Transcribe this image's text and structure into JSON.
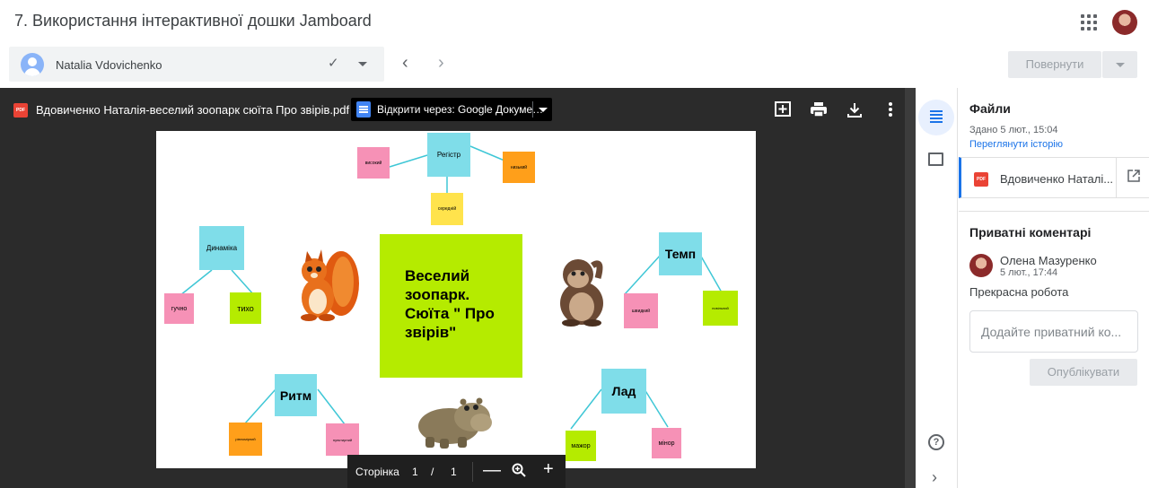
{
  "header": {
    "title": "7. Використання інтерактивної дошки Jamboard"
  },
  "student": {
    "name": "Natalia Vdovichenko",
    "check_icon": "check-icon"
  },
  "toolbar": {
    "return_label": "Повернути",
    "prev_icon": "chevron-left-icon",
    "next_icon": "chevron-right-icon"
  },
  "viewer": {
    "pdf_badge": "PDF",
    "file_name": "Вдовиченко Наталія-веселий зоопарк сюїта Про звірів.pdf",
    "open_with": "Відкрити через: Google Докуме…",
    "actions": [
      "add-comment-icon",
      "print-icon",
      "download-icon",
      "more-vert-icon"
    ],
    "page_label": "Сторінка",
    "page_current": "1",
    "page_sep": "/",
    "page_total": "1"
  },
  "jamboard": {
    "center": "Веселий зоопарк. Сюїта \" Про звірів\"",
    "register": {
      "title": "Регістр",
      "high": "високий",
      "low": "низький",
      "middle": "середній"
    },
    "dynamics": {
      "title": "Динаміка",
      "loud": "гучно",
      "quiet": "тихо"
    },
    "tempo": {
      "title": "Темп",
      "fast": "швидкий",
      "slow": "повільний"
    },
    "rhythm": {
      "title": "Ритм",
      "even": "рівномірний",
      "dotted": "пунктирний"
    },
    "mode": {
      "title": "Лад",
      "major": "мажор",
      "minor": "мінор"
    }
  },
  "panel": {
    "files_title": "Файли",
    "submitted": "Здано 5 лют., 15:04",
    "history_link": "Переглянути історію",
    "file_badge": "PDF",
    "file_name": "Вдовиченко Наталі...",
    "private_title": "Приватні коментарі",
    "comment_author": "Олена Мазуренко",
    "comment_time": "5 лют., 17:44",
    "comment_text": "Прекрасна робота",
    "comment_placeholder": "Додайте приватний ко...",
    "publish_label": "Опублікувати"
  },
  "colors": {
    "accent": "#1a73e8",
    "viewer_bg": "#2b2b2b",
    "sticky_cyan": "#7fdde9",
    "sticky_pink": "#f691b6",
    "sticky_orange": "#ff9f1a",
    "sticky_yellow": "#ffe34c",
    "sticky_lime": "#b5eb00"
  }
}
